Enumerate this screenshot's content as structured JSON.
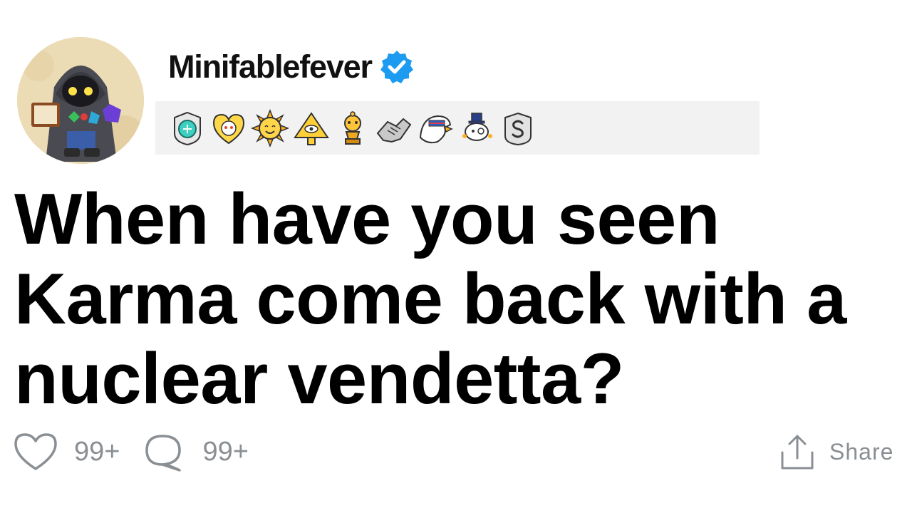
{
  "post": {
    "username": "Minifablefever",
    "verified": true,
    "title": "When have you seen Karma come back with a nuclear vendetta?"
  },
  "awards": [
    {
      "icon": "gem-shield-award-icon"
    },
    {
      "icon": "wholesome-heart-award-icon"
    },
    {
      "icon": "sun-face-award-icon"
    },
    {
      "icon": "eye-pyramid-award-icon"
    },
    {
      "icon": "gold-trophy-award-icon"
    },
    {
      "icon": "handshake-award-icon"
    },
    {
      "icon": "eagle-award-icon"
    },
    {
      "icon": "snoo-gentleman-award-icon"
    },
    {
      "icon": "silver-s-award-icon"
    }
  ],
  "actions": {
    "likes": "99+",
    "comments": "99+",
    "share_label": "Share"
  },
  "colors": {
    "verified_blue": "#1d9bf0",
    "count_gray": "#8a8f94",
    "award_bar_bg": "#f2f2f2"
  }
}
